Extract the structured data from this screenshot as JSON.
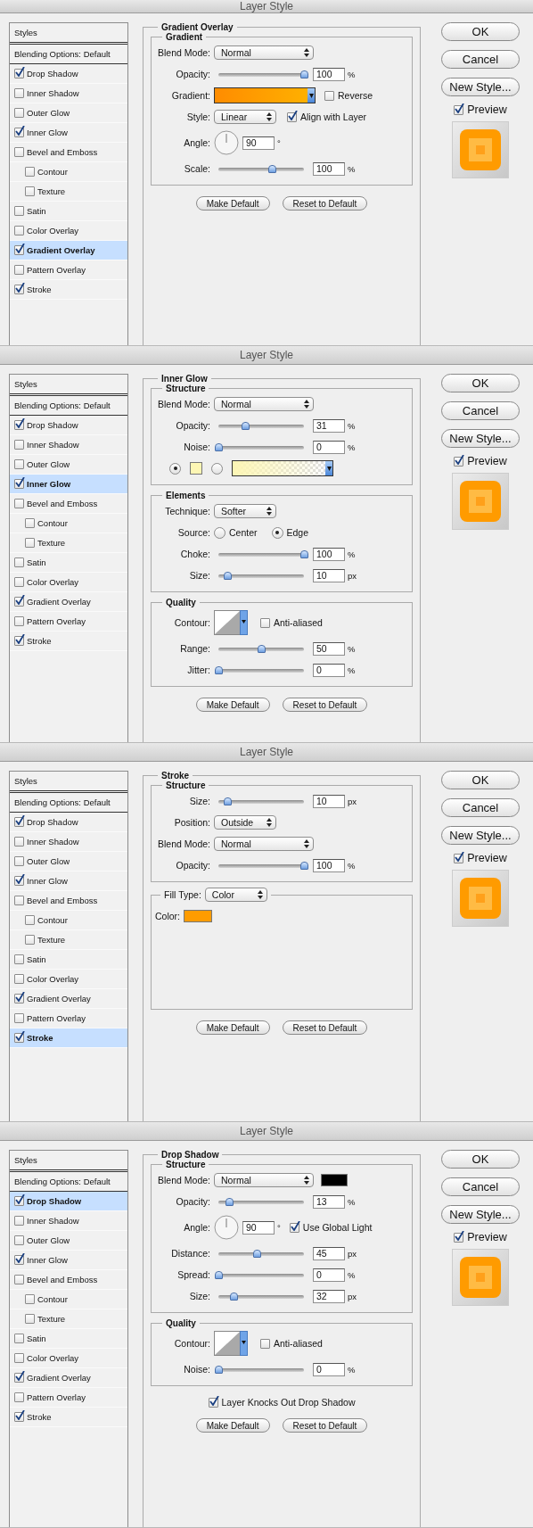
{
  "dialogs": [
    {
      "title": "Layer Style",
      "styles_header": "Styles",
      "blending": "Blending Options: Default",
      "style_items": [
        {
          "label": "Drop Shadow",
          "checked": true,
          "selected": false
        },
        {
          "label": "Inner Shadow",
          "checked": false,
          "selected": false
        },
        {
          "label": "Outer Glow",
          "checked": false,
          "selected": false
        },
        {
          "label": "Inner Glow",
          "checked": true,
          "selected": false
        },
        {
          "label": "Bevel and Emboss",
          "checked": false,
          "selected": false,
          "children": [
            {
              "label": "Contour",
              "checked": false,
              "selected": false
            },
            {
              "label": "Texture",
              "checked": false,
              "selected": false
            }
          ]
        },
        {
          "label": "Satin",
          "checked": false,
          "selected": false
        },
        {
          "label": "Color Overlay",
          "checked": false,
          "selected": false
        },
        {
          "label": "Gradient Overlay",
          "checked": true,
          "selected": true
        },
        {
          "label": "Pattern Overlay",
          "checked": false,
          "selected": false
        },
        {
          "label": "Stroke",
          "checked": true,
          "selected": false
        }
      ],
      "section_title": "Gradient Overlay",
      "groups": [
        {
          "title": "Gradient",
          "rows": [
            {
              "kind": "select",
              "label": "Blend Mode:",
              "value": "Normal",
              "wide": true
            },
            {
              "kind": "slider",
              "label": "Opacity:",
              "level": 1,
              "value": "100",
              "unit": "%"
            },
            {
              "kind": "gradient",
              "label": "Gradient:",
              "checkbox": {
                "label": "Reverse",
                "checked": false
              }
            },
            {
              "kind": "select",
              "label": "Style:",
              "value": "Linear",
              "wide": false,
              "checkbox": {
                "label": "Align with Layer",
                "checked": true
              }
            },
            {
              "kind": "angle",
              "label": "Angle:",
              "value": "90",
              "unit": "°"
            },
            {
              "kind": "slider",
              "label": "Scale:",
              "level": 0.62,
              "value": "100",
              "unit": "%"
            }
          ]
        }
      ],
      "buttons": [
        "Make Default",
        "Reset to Default"
      ],
      "side_buttons": [
        "OK",
        "Cancel",
        "New Style..."
      ],
      "preview": {
        "label": "Preview",
        "checked": true
      }
    },
    {
      "title": "Layer Style",
      "styles_header": "Styles",
      "blending": "Blending Options: Default",
      "style_items": [
        {
          "label": "Drop Shadow",
          "checked": true,
          "selected": false
        },
        {
          "label": "Inner Shadow",
          "checked": false,
          "selected": false
        },
        {
          "label": "Outer Glow",
          "checked": false,
          "selected": false
        },
        {
          "label": "Inner Glow",
          "checked": true,
          "selected": true
        },
        {
          "label": "Bevel and Emboss",
          "checked": false,
          "selected": false,
          "children": [
            {
              "label": "Contour",
              "checked": false,
              "selected": false
            },
            {
              "label": "Texture",
              "checked": false,
              "selected": false
            }
          ]
        },
        {
          "label": "Satin",
          "checked": false,
          "selected": false
        },
        {
          "label": "Color Overlay",
          "checked": false,
          "selected": false
        },
        {
          "label": "Gradient Overlay",
          "checked": true,
          "selected": false
        },
        {
          "label": "Pattern Overlay",
          "checked": false,
          "selected": false
        },
        {
          "label": "Stroke",
          "checked": true,
          "selected": false
        }
      ],
      "section_title": "Inner Glow",
      "groups": [
        {
          "title": "Structure",
          "rows": [
            {
              "kind": "select",
              "label": "Blend Mode:",
              "value": "Normal",
              "wide": true
            },
            {
              "kind": "slider",
              "label": "Opacity:",
              "level": 0.31,
              "value": "31",
              "unit": "%"
            },
            {
              "kind": "slider",
              "label": "Noise:",
              "level": 0,
              "value": "0",
              "unit": "%"
            },
            {
              "kind": "fill-source",
              "solid": {
                "selected": true,
                "color": "#fdf6b4"
              },
              "gradient": {
                "selected": false,
                "color": "#fdf6b4"
              }
            }
          ]
        },
        {
          "title": "Elements",
          "rows": [
            {
              "kind": "select",
              "label": "Technique:",
              "value": "Softer",
              "wide": false
            },
            {
              "kind": "radio",
              "label": "Source:",
              "options": [
                {
                  "label": "Center",
                  "selected": false
                },
                {
                  "label": "Edge",
                  "selected": true
                }
              ]
            },
            {
              "kind": "slider",
              "label": "Choke:",
              "level": 1,
              "value": "100",
              "unit": "%"
            },
            {
              "kind": "slider",
              "label": "Size:",
              "level": 0.1,
              "value": "10",
              "unit": "px"
            }
          ]
        },
        {
          "title": "Quality",
          "rows": [
            {
              "kind": "contour",
              "label": "Contour:",
              "checkbox": {
                "label": "Anti-aliased",
                "checked": false
              }
            },
            {
              "kind": "slider",
              "label": "Range:",
              "level": 0.5,
              "value": "50",
              "unit": "%"
            },
            {
              "kind": "slider",
              "label": "Jitter:",
              "level": 0,
              "value": "0",
              "unit": "%"
            }
          ]
        }
      ],
      "buttons": [
        "Make Default",
        "Reset to Default"
      ],
      "side_buttons": [
        "OK",
        "Cancel",
        "New Style..."
      ],
      "preview": {
        "label": "Preview",
        "checked": true
      }
    },
    {
      "title": "Layer Style",
      "styles_header": "Styles",
      "blending": "Blending Options: Default",
      "style_items": [
        {
          "label": "Drop Shadow",
          "checked": true,
          "selected": false
        },
        {
          "label": "Inner Shadow",
          "checked": false,
          "selected": false
        },
        {
          "label": "Outer Glow",
          "checked": false,
          "selected": false
        },
        {
          "label": "Inner Glow",
          "checked": true,
          "selected": false
        },
        {
          "label": "Bevel and Emboss",
          "checked": false,
          "selected": false,
          "children": [
            {
              "label": "Contour",
              "checked": false,
              "selected": false
            },
            {
              "label": "Texture",
              "checked": false,
              "selected": false
            }
          ]
        },
        {
          "label": "Satin",
          "checked": false,
          "selected": false
        },
        {
          "label": "Color Overlay",
          "checked": false,
          "selected": false
        },
        {
          "label": "Gradient Overlay",
          "checked": true,
          "selected": false
        },
        {
          "label": "Pattern Overlay",
          "checked": false,
          "selected": false
        },
        {
          "label": "Stroke",
          "checked": true,
          "selected": true
        }
      ],
      "section_title": "Stroke",
      "groups": [
        {
          "title": "Structure",
          "rows": [
            {
              "kind": "slider",
              "label": "Size:",
              "level": 0.1,
              "value": "10",
              "unit": "px"
            },
            {
              "kind": "select",
              "label": "Position:",
              "value": "Outside",
              "wide": false
            },
            {
              "kind": "select",
              "label": "Blend Mode:",
              "value": "Normal",
              "wide": true
            },
            {
              "kind": "slider",
              "label": "Opacity:",
              "level": 1,
              "value": "100",
              "unit": "%"
            }
          ]
        },
        {
          "title_select": {
            "label": "Fill Type:",
            "value": "Color"
          },
          "rows": [
            {
              "kind": "color",
              "label": "Color:",
              "color": "#ff9c00"
            }
          ]
        }
      ],
      "buttons": [
        "Make Default",
        "Reset to Default"
      ],
      "side_buttons": [
        "OK",
        "Cancel",
        "New Style..."
      ],
      "preview": {
        "label": "Preview",
        "checked": true
      }
    },
    {
      "title": "Layer Style",
      "styles_header": "Styles",
      "blending": "Blending Options: Default",
      "style_items": [
        {
          "label": "Drop Shadow",
          "checked": true,
          "selected": true
        },
        {
          "label": "Inner Shadow",
          "checked": false,
          "selected": false
        },
        {
          "label": "Outer Glow",
          "checked": false,
          "selected": false
        },
        {
          "label": "Inner Glow",
          "checked": true,
          "selected": false
        },
        {
          "label": "Bevel and Emboss",
          "checked": false,
          "selected": false,
          "children": [
            {
              "label": "Contour",
              "checked": false,
              "selected": false
            },
            {
              "label": "Texture",
              "checked": false,
              "selected": false
            }
          ]
        },
        {
          "label": "Satin",
          "checked": false,
          "selected": false
        },
        {
          "label": "Color Overlay",
          "checked": false,
          "selected": false
        },
        {
          "label": "Gradient Overlay",
          "checked": true,
          "selected": false
        },
        {
          "label": "Pattern Overlay",
          "checked": false,
          "selected": false
        },
        {
          "label": "Stroke",
          "checked": true,
          "selected": false
        }
      ],
      "section_title": "Drop Shadow",
      "groups": [
        {
          "title": "Structure",
          "rows": [
            {
              "kind": "select",
              "label": "Blend Mode:",
              "value": "Normal",
              "wide": true,
              "color": "#000000"
            },
            {
              "kind": "slider",
              "label": "Opacity:",
              "level": 0.13,
              "value": "13",
              "unit": "%"
            },
            {
              "kind": "angle",
              "label": "Angle:",
              "value": "90",
              "unit": "°",
              "checkbox": {
                "label": "Use Global Light",
                "checked": true
              }
            },
            {
              "kind": "slider",
              "label": "Distance:",
              "level": 0.45,
              "value": "45",
              "unit": "px"
            },
            {
              "kind": "slider",
              "label": "Spread:",
              "level": 0,
              "value": "0",
              "unit": "%"
            },
            {
              "kind": "slider",
              "label": "Size:",
              "level": 0.18,
              "value": "32",
              "unit": "px"
            }
          ]
        },
        {
          "title": "Quality",
          "rows": [
            {
              "kind": "contour",
              "label": "Contour:",
              "checkbox": {
                "label": "Anti-aliased",
                "checked": false
              }
            },
            {
              "kind": "slider",
              "label": "Noise:",
              "level": 0,
              "value": "0",
              "unit": "%"
            }
          ]
        }
      ],
      "extra_checkbox": {
        "label": "Layer Knocks Out Drop Shadow",
        "checked": true
      },
      "buttons": [
        "Make Default",
        "Reset to Default"
      ],
      "side_buttons": [
        "OK",
        "Cancel",
        "New Style..."
      ],
      "preview": {
        "label": "Preview",
        "checked": true
      }
    }
  ]
}
